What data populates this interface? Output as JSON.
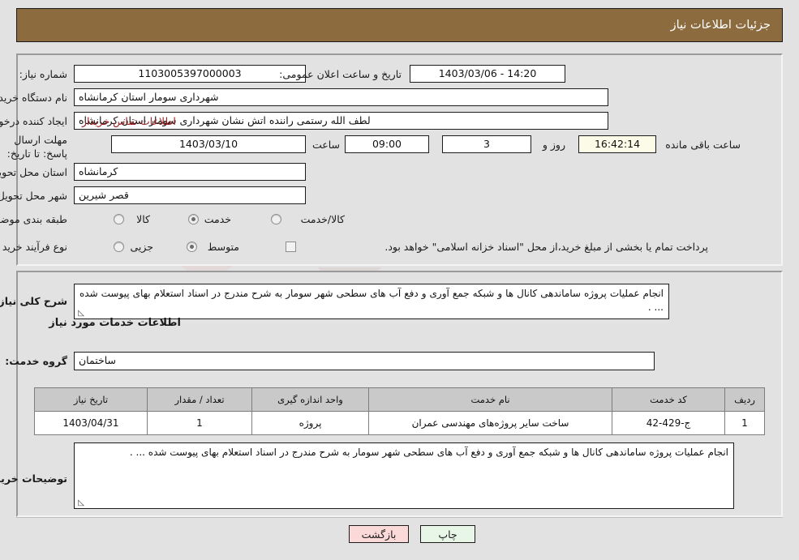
{
  "header": {
    "title": "جزئیات اطلاعات نیاز"
  },
  "form": {
    "need_number_label": "شماره نیاز:",
    "need_number_value": "1103005397000003",
    "announce_label": "تاریخ و ساعت اعلان عمومی:",
    "announce_value": "14:20 - 1403/03/06",
    "buyer_org_label": "نام دستگاه خریدار:",
    "buyer_org_value": "شهرداری سومار استان کرمانشاه",
    "creator_label": "ایجاد کننده درخواست:",
    "creator_value": "لطف الله رستمی راننده اتش نشان شهرداری سومار استان کرمانشاه",
    "contact_link": "اطلاعات تماس خریدار",
    "deadline_label": "مهلت ارسال پاسخ: تا تاریخ:",
    "deadline_date": "1403/03/10",
    "hour_label": "ساعت",
    "deadline_time": "09:00",
    "days_value": "3",
    "days_label": "روز و",
    "countdown_value": "16:42:14",
    "remaining_label": "ساعت باقی مانده",
    "province_label": "استان محل تحویل:",
    "province_value": "کرمانشاه",
    "city_label": "شهر محل تحویل:",
    "city_value": "قصر شیرین",
    "category_label": "طبقه بندی موضوعی:",
    "category_options": [
      {
        "label": "کالا",
        "selected": false
      },
      {
        "label": "خدمت",
        "selected": true
      },
      {
        "label": "کالا/خدمت",
        "selected": false
      }
    ],
    "process_label": "نوع فرآیند خرید :",
    "process_options": [
      {
        "label": "جزیی",
        "selected": false
      },
      {
        "label": "متوسط",
        "selected": true
      }
    ],
    "treasury_checkbox_label": "پرداخت تمام یا بخشی از مبلغ خرید،از محل \"اسناد خزانه اسلامی\" خواهد بود.",
    "treasury_checked": false
  },
  "description": {
    "need_summary_label": "شرح کلی نیاز:",
    "need_summary_value": "انجام عملیات پروژه ساماندهی کانال ها و شبکه جمع آوری و دفع آب های سطحی شهر سومار به شرح مندرج در اسناد استعلام بهای پیوست شده ... .",
    "services_heading": "اطلاعات خدمات مورد نیاز",
    "service_group_label": "گروه خدمت:",
    "service_group_value": "ساختمان",
    "buyer_notes_label": "توضیحات خریدار:",
    "buyer_notes_value": "انجام عملیات پروژه ساماندهی کانال ها و شبکه جمع آوری و دفع آب های سطحی شهر سومار به شرح مندرج در اسناد استعلام بهای پیوست شده ... ."
  },
  "table": {
    "headers": [
      "ردیف",
      "کد خدمت",
      "نام خدمت",
      "واحد اندازه گیری",
      "تعداد / مقدار",
      "تاریخ نیاز"
    ],
    "rows": [
      {
        "row": "1",
        "code": "ج-429-42",
        "name": "ساخت سایر پروژه‌های مهندسی عمران",
        "unit": "پروژه",
        "quantity": "1",
        "date": "1403/04/31"
      }
    ]
  },
  "buttons": {
    "print": "چاپ",
    "back": "بازگشت"
  },
  "watermark": {
    "text": "AriaTender.net"
  },
  "colors": {
    "header_bg": "#8c6b3f",
    "page_bg": "#e2e2e2",
    "link": "#9c1f20",
    "print_btn": "#e8f6e8",
    "back_btn": "#fbd9d9",
    "countdown_bg": "#fbfbe8"
  }
}
